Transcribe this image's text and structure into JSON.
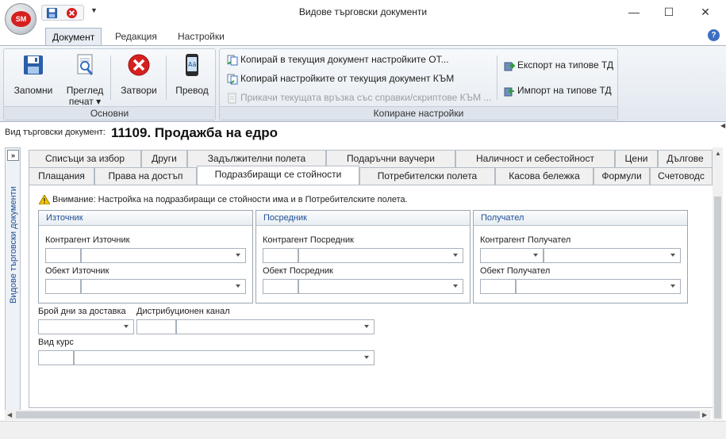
{
  "window": {
    "title": "Видове търговски документи",
    "app_logo_text": "SM",
    "minimize": "—",
    "maximize": "☐",
    "close": "✕",
    "qat_more": "▼"
  },
  "ribbon_tabs": [
    "Документ",
    "Редакция",
    "Настройки"
  ],
  "ribbon": {
    "group_basic": {
      "label": "Основни",
      "save": "Запомни",
      "preview_line1": "Преглед",
      "preview_line2": "печат ▾",
      "close": "Затвори",
      "translate": "Превод"
    },
    "group_copy": {
      "label": "Копиране настройки",
      "copy_from": "Копирай в текущия документ настройките ОТ...",
      "copy_to": "Копирай настройките от текущия документ КЪМ",
      "attach": "Прикачи текущата връзка със справки/скриптове КЪМ ...",
      "export": "Експорт на типове ТД",
      "import": "Импорт на типове ТД"
    }
  },
  "doc_type": {
    "label": "Вид търговски документ:",
    "value": "11109. Продажба на едро"
  },
  "side_panel": {
    "label": "Видове търговски документи",
    "toggle": "»"
  },
  "tabs_row1": [
    "Списъци за избор",
    "Други",
    "Задължителни полета",
    "Подаръчни ваучери",
    "Наличност и себестойност",
    "Цени",
    "Дългове"
  ],
  "tabs_row2": [
    "Плащания",
    "Права на достъп",
    "Подразбиращи се стойности",
    "Потребителски полета",
    "Касова бележка",
    "Формули",
    "Счетоводс"
  ],
  "warning": "Внимание: Настройка на подразбиращи се стойности има и в Потребителските полета.",
  "panels": {
    "source": {
      "title": "Източник",
      "contractor": "Контрагент Източник",
      "object": "Обект Източник"
    },
    "mediator": {
      "title": "Посредник",
      "contractor": "Контрагент Посредник",
      "object": "Обект Посредник"
    },
    "recipient": {
      "title": "Получател",
      "contractor": "Контрагент Получател",
      "object": "Обект Получател"
    }
  },
  "fields": {
    "delivery_days": "Брой дни за доставка",
    "distribution_channel": "Дистрибуционен канал",
    "rate_type": "Вид курс"
  },
  "colors": {
    "accent": "#1f4f95",
    "ribbon_bg": "#e2e8ef",
    "close_red": "#d62020"
  }
}
